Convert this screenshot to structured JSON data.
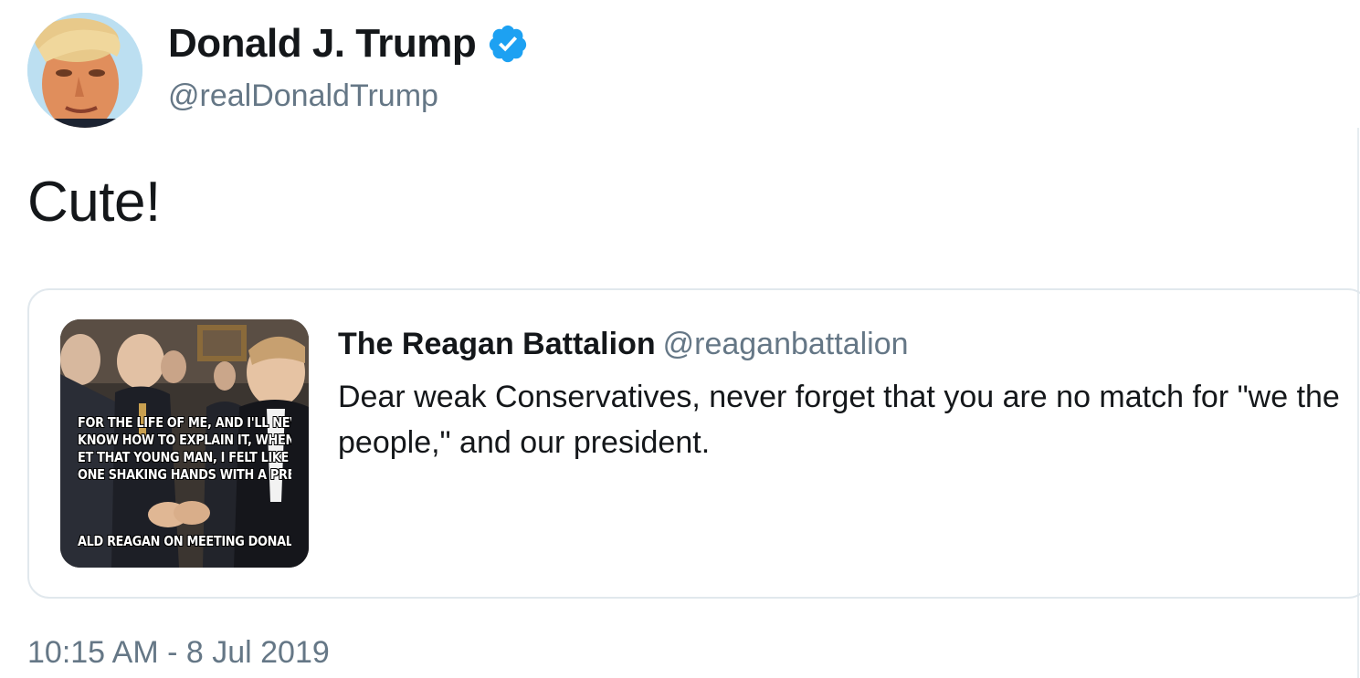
{
  "author": {
    "display_name": "Donald J. Trump",
    "handle": "@realDonaldTrump",
    "verified": true,
    "avatar_icon": "avatar",
    "verified_icon": "verified-badge-icon"
  },
  "tweet": {
    "text": "Cute!",
    "timestamp": "10:15 AM - 8 Jul 2019"
  },
  "quoted_tweet": {
    "display_name": "The Reagan Battalion",
    "handle": "@reaganbattalion",
    "text": "Dear weak Conservatives, never forget that you are no match for \"we the people,\" and our president.",
    "media": {
      "caption_lines": [
        "FOR THE LIFE OF ME, AND I'LL NEVER",
        "KNOW HOW TO EXPLAIN IT, WHEN I",
        "ET THAT YOUNG MAN, I FELT LIKE I W",
        "ONE SHAKING HANDS WITH A PRESI"
      ],
      "attribution": "ALD REAGAN ON MEETING DONALD T"
    }
  },
  "colors": {
    "text_primary": "#14171a",
    "text_secondary": "#657786",
    "verified_blue": "#1da1f2",
    "border": "#e1e8ed"
  }
}
